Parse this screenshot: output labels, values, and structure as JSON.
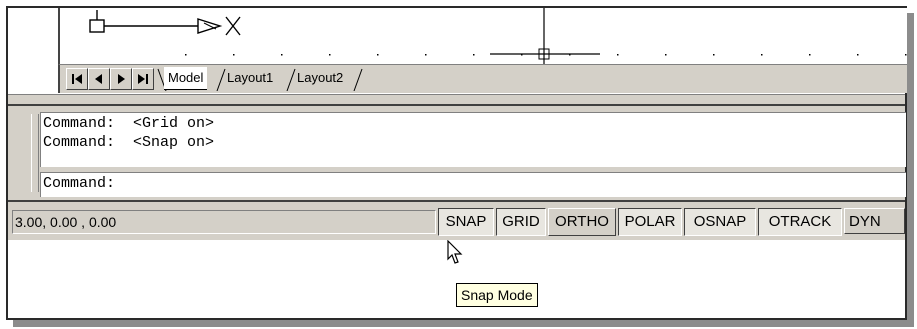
{
  "layout_tabs": {
    "nav_buttons": [
      "first-tab-icon",
      "prev-tab-icon",
      "next-tab-icon",
      "last-tab-icon"
    ],
    "tabs": [
      {
        "label": "Model",
        "active": true
      },
      {
        "label": "Layout1",
        "active": false
      },
      {
        "label": "Layout2",
        "active": false
      }
    ]
  },
  "command_window": {
    "history": [
      {
        "prompt": "Command:",
        "message": "<Grid on>"
      },
      {
        "prompt": "Command:",
        "message": "<Snap on>"
      }
    ],
    "input_prompt": "Command:"
  },
  "status_bar": {
    "coordinates": "3.00, 0.00 , 0.00",
    "toggles": [
      {
        "label": "SNAP",
        "state": "on"
      },
      {
        "label": "GRID",
        "state": "on"
      },
      {
        "label": "ORTHO",
        "state": "off"
      },
      {
        "label": "POLAR",
        "state": "on"
      },
      {
        "label": "OSNAP",
        "state": "on"
      },
      {
        "label": "OTRACK",
        "state": "on"
      },
      {
        "label": "DYN",
        "state": "off"
      }
    ]
  },
  "tooltip": {
    "text": "Snap Mode"
  },
  "colors": {
    "face": "#d4d0c8",
    "tooltip_bg": "#ffffe1"
  }
}
